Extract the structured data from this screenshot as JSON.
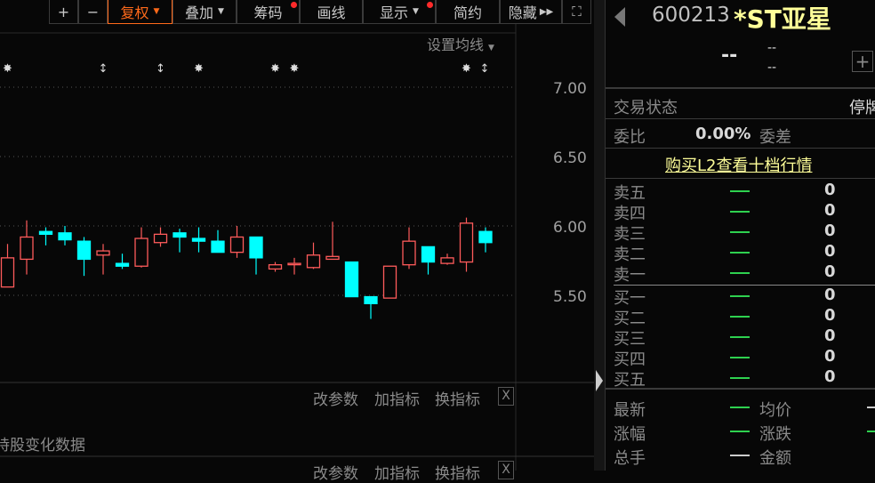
{
  "toolbar": {
    "zoom_in": "+",
    "zoom_out": "−",
    "fuquan": "复权",
    "diejia": "叠加",
    "chouma": "筹码",
    "huaxian": "画线",
    "xianshi": "显示",
    "jianyue": "简约",
    "yincang": "隐藏",
    "fullscreen_icon": "expand-icon"
  },
  "chart": {
    "ma_setting": "设置均线",
    "price_labels": [
      "7.00",
      "6.50",
      "6.00",
      "5.50"
    ]
  },
  "chart_data": {
    "type": "candlestick",
    "ylim": [
      5.3,
      7.05
    ],
    "yticks": [
      7.0,
      6.5,
      6.0,
      5.5
    ],
    "candles": [
      {
        "o": 5.56,
        "c": 5.77,
        "h": 5.87,
        "l": 5.56
      },
      {
        "o": 5.76,
        "c": 5.92,
        "h": 6.04,
        "l": 5.65
      },
      {
        "o": 5.96,
        "c": 5.94,
        "h": 5.99,
        "l": 5.86
      },
      {
        "o": 5.95,
        "c": 5.9,
        "h": 6.0,
        "l": 5.86
      },
      {
        "o": 5.89,
        "c": 5.76,
        "h": 5.92,
        "l": 5.64
      },
      {
        "o": 5.79,
        "c": 5.82,
        "h": 5.87,
        "l": 5.65
      },
      {
        "o": 5.73,
        "c": 5.71,
        "h": 5.8,
        "l": 5.69
      },
      {
        "o": 5.71,
        "c": 5.91,
        "h": 5.99,
        "l": 5.7
      },
      {
        "o": 5.88,
        "c": 5.94,
        "h": 5.99,
        "l": 5.85
      },
      {
        "o": 5.95,
        "c": 5.92,
        "h": 5.98,
        "l": 5.81
      },
      {
        "o": 5.91,
        "c": 5.89,
        "h": 5.99,
        "l": 5.81
      },
      {
        "o": 5.89,
        "c": 5.81,
        "h": 5.97,
        "l": 5.81
      },
      {
        "o": 5.81,
        "c": 5.92,
        "h": 6.0,
        "l": 5.77
      },
      {
        "o": 5.92,
        "c": 5.77,
        "h": 5.92,
        "l": 5.65
      },
      {
        "o": 5.69,
        "c": 5.72,
        "h": 5.74,
        "l": 5.67
      },
      {
        "o": 5.73,
        "c": 5.73,
        "h": 5.77,
        "l": 5.65
      },
      {
        "o": 5.7,
        "c": 5.79,
        "h": 5.88,
        "l": 5.69
      },
      {
        "o": 5.76,
        "c": 5.78,
        "h": 6.03,
        "l": 5.76
      },
      {
        "o": 5.74,
        "c": 5.49,
        "h": 5.74,
        "l": 5.49
      },
      {
        "o": 5.49,
        "c": 5.44,
        "h": 5.49,
        "l": 5.33
      },
      {
        "o": 5.48,
        "c": 5.71,
        "h": 5.71,
        "l": 5.48
      },
      {
        "o": 5.72,
        "c": 5.89,
        "h": 5.99,
        "l": 5.69
      },
      {
        "o": 5.85,
        "c": 5.74,
        "h": 5.85,
        "l": 5.65
      },
      {
        "o": 5.73,
        "c": 5.77,
        "h": 5.8,
        "l": 5.72
      },
      {
        "o": 5.74,
        "c": 6.02,
        "h": 6.06,
        "l": 5.67
      },
      {
        "o": 5.96,
        "c": 5.88,
        "h": 5.99,
        "l": 5.81
      }
    ],
    "markers": [
      {
        "i": 0,
        "t": "star"
      },
      {
        "i": 5,
        "t": "arrow"
      },
      {
        "i": 8,
        "t": "arrow"
      },
      {
        "i": 10,
        "t": "star"
      },
      {
        "i": 14,
        "t": "star"
      },
      {
        "i": 15,
        "t": "star"
      },
      {
        "i": 24,
        "t": "star"
      },
      {
        "i": 26,
        "t": "arrow"
      }
    ],
    "colors": {
      "up": "#ff5b5b",
      "down": "#00ffff"
    }
  },
  "indicator": {
    "change_params": "改参数",
    "add_indicator": "加指标",
    "switch_indicator": "换指标",
    "close": "X",
    "holding_text": "持股变化数据"
  },
  "quote": {
    "code": "600213",
    "name": "*ST亚星",
    "price": "--",
    "change1": "--",
    "change2": "--",
    "status_label": "交易状态",
    "status_value": "停牌",
    "wb_label": "委比",
    "wb_value": "0.00%",
    "wc_label": "委差",
    "l2_link": "购买L2查看十档行情",
    "sells": [
      {
        "label": "卖五",
        "vol": "0"
      },
      {
        "label": "卖四",
        "vol": "0"
      },
      {
        "label": "卖三",
        "vol": "0"
      },
      {
        "label": "卖二",
        "vol": "0"
      },
      {
        "label": "卖一",
        "vol": "0"
      }
    ],
    "buys": [
      {
        "label": "买一",
        "vol": "0"
      },
      {
        "label": "买二",
        "vol": "0"
      },
      {
        "label": "买三",
        "vol": "0"
      },
      {
        "label": "买四",
        "vol": "0"
      },
      {
        "label": "买五",
        "vol": "0"
      }
    ],
    "stats": {
      "latest": "最新",
      "avg": "均价",
      "pct": "涨幅",
      "chg": "涨跌",
      "vol": "总手",
      "amount": "金额"
    }
  }
}
